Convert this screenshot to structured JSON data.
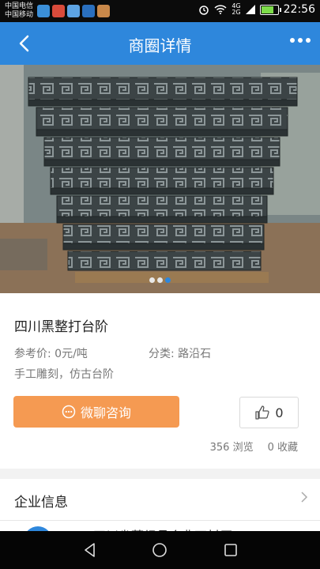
{
  "status": {
    "carrier1": "中国电信",
    "carrier2": "中国移动",
    "net1": "4G",
    "net2": "2G",
    "time": "22:56"
  },
  "header": {
    "title": "商圈详情"
  },
  "gallery": {
    "current_index": 3,
    "total": 3
  },
  "product": {
    "name": "四川黑整打台阶",
    "price_label": "参考价:",
    "price_value": "0元/吨",
    "category_label": "分类:",
    "category_value": "路沿石",
    "description": "手工雕刻，仿古台阶",
    "consult_label": "微聊咨询",
    "like_count": "0",
    "views": "356 浏览",
    "favorites": "0 收藏"
  },
  "enterprise": {
    "section_title": "企业信息",
    "company_name": "四川省蒂经县合典石材厂"
  },
  "colors": {
    "primary": "#2e87dc",
    "accent": "#f59a52"
  },
  "icons": [
    "back-arrow-icon",
    "more-icon",
    "chat-icon",
    "thumb-up-icon",
    "chevron-right-icon",
    "nav-back-icon",
    "nav-home-icon",
    "nav-recent-icon"
  ]
}
